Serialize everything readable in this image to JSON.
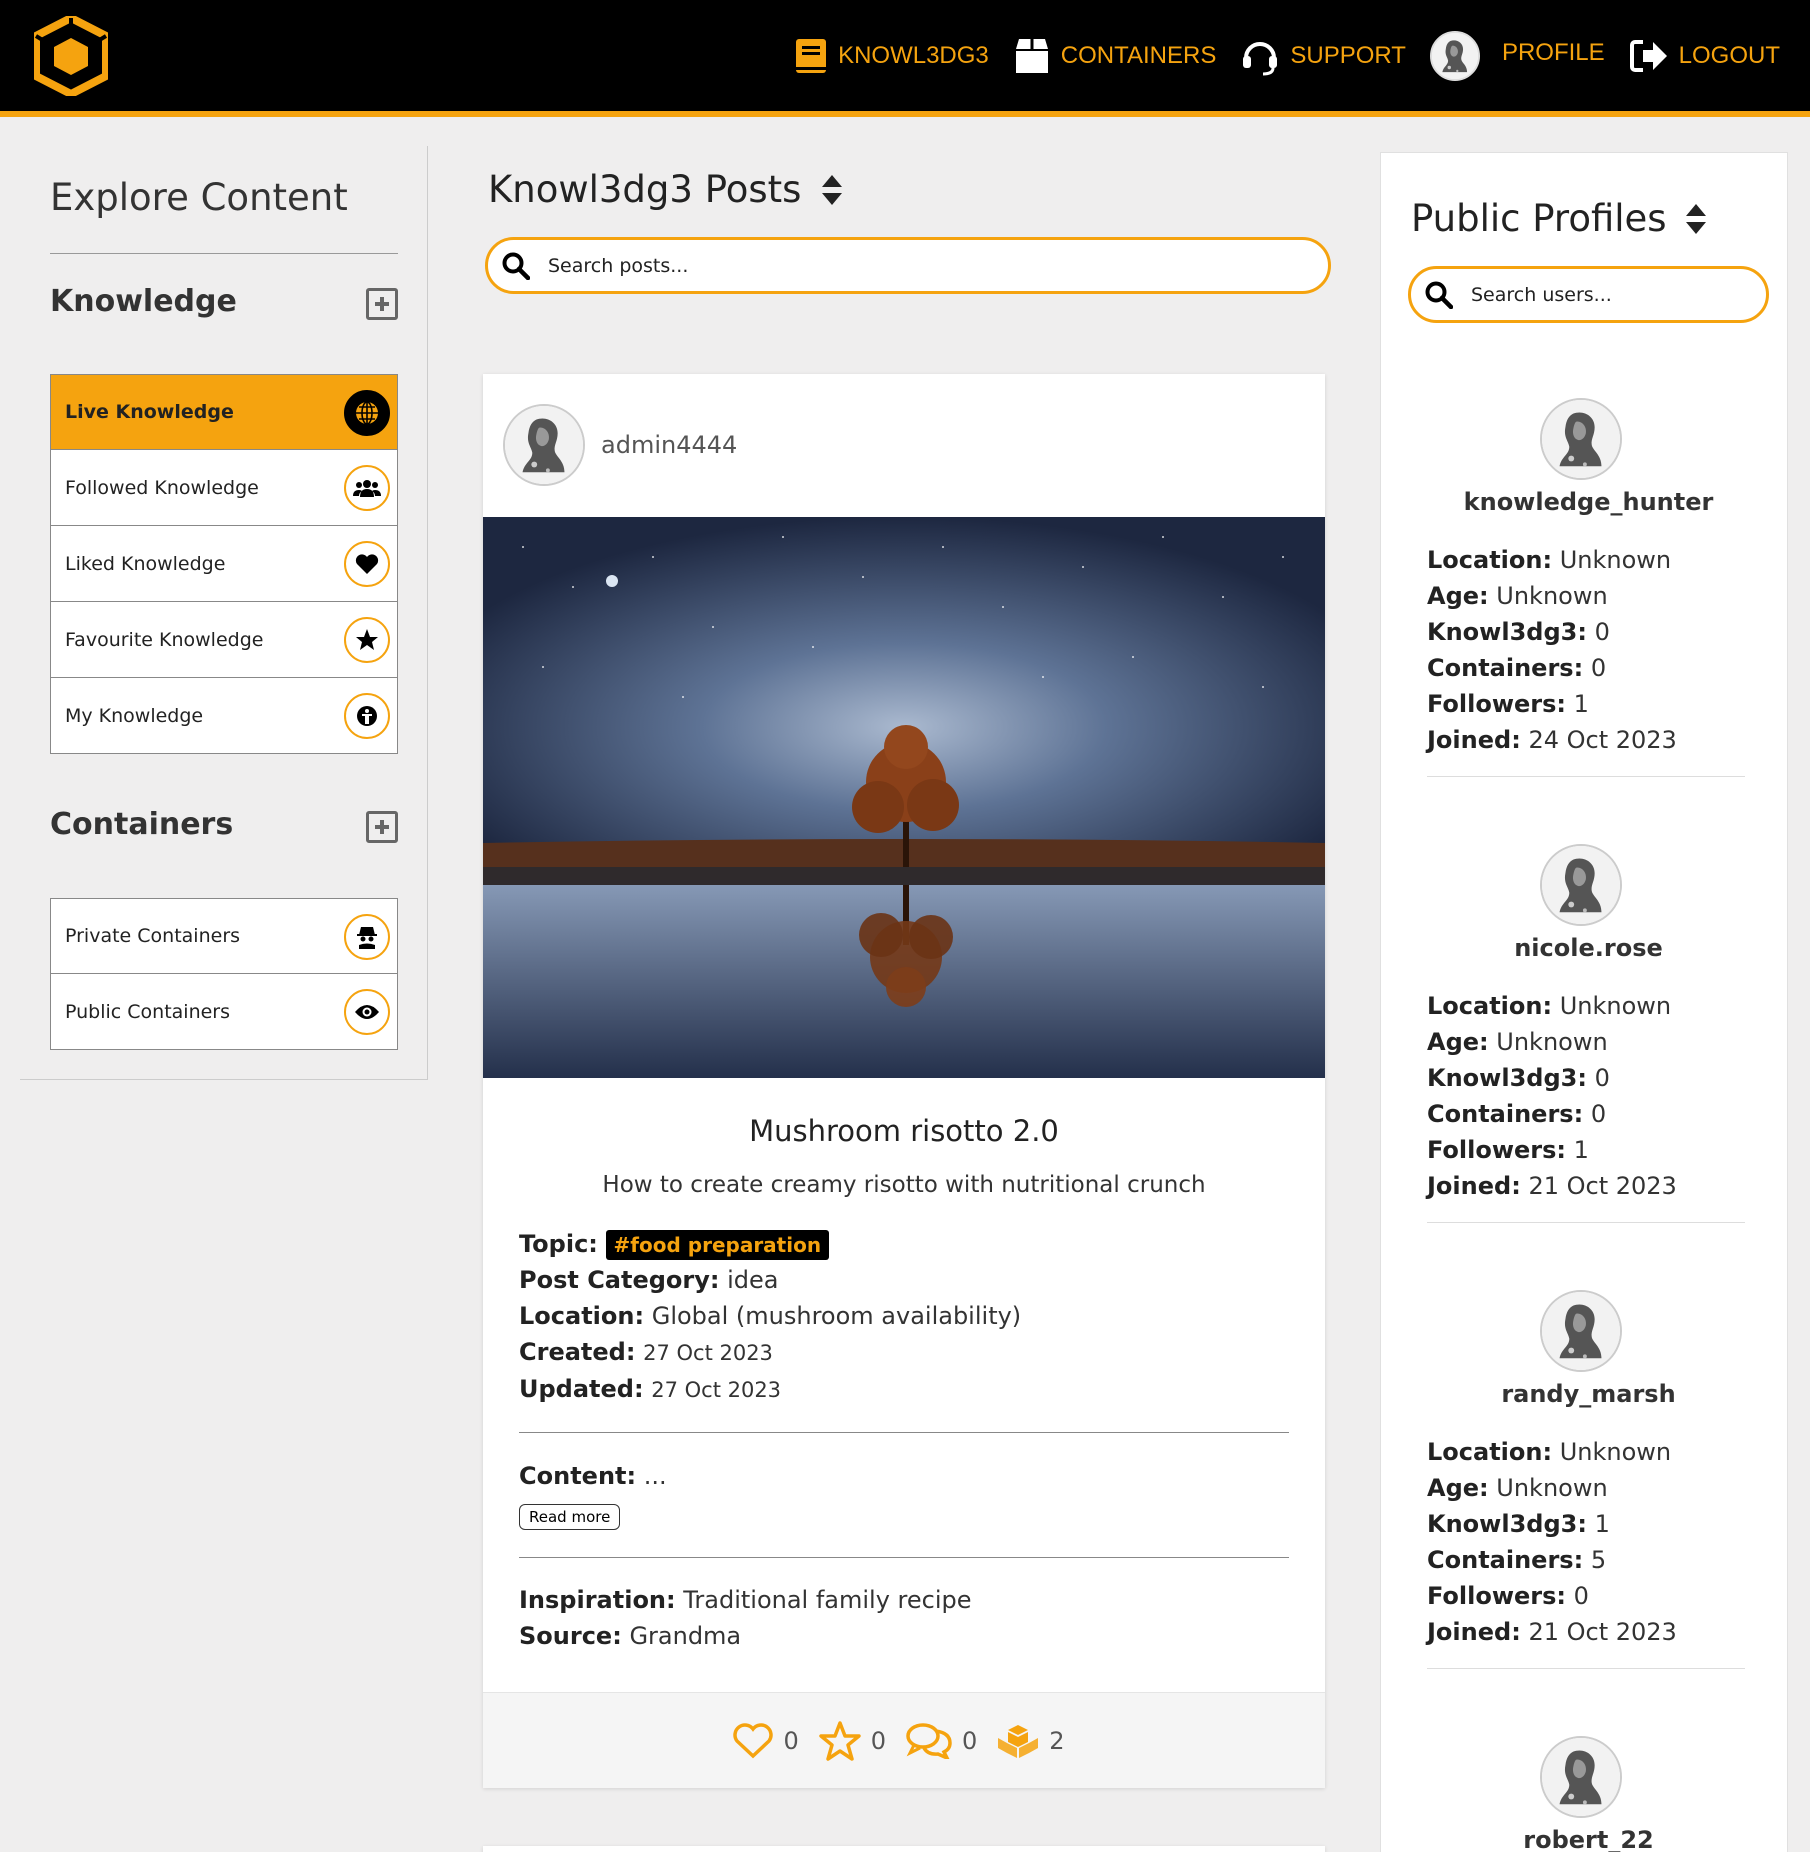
{
  "nav": {
    "links": [
      {
        "label": "KNOWL3DG3",
        "icon": "book-icon"
      },
      {
        "label": "CONTAINERS",
        "icon": "box-icon"
      },
      {
        "label": "SUPPORT",
        "icon": "headset-icon"
      },
      {
        "label": "PROFILE",
        "icon": "avatar"
      },
      {
        "label": "LOGOUT",
        "icon": "logout-icon"
      }
    ],
    "accent": "#f5a30f"
  },
  "sidebar": {
    "title": "Explore Content",
    "knowledge_heading": "Knowledge",
    "knowledge_items": [
      {
        "label": "Live Knowledge",
        "icon": "globe-icon",
        "active": true
      },
      {
        "label": "Followed Knowledge",
        "icon": "users-icon"
      },
      {
        "label": "Liked Knowledge",
        "icon": "heart-icon"
      },
      {
        "label": "Favourite Knowledge",
        "icon": "star-icon"
      },
      {
        "label": "My Knowledge",
        "icon": "person-icon"
      }
    ],
    "containers_heading": "Containers",
    "container_items": [
      {
        "label": "Private Containers",
        "icon": "spy-icon"
      },
      {
        "label": "Public Containers",
        "icon": "eye-icon"
      }
    ]
  },
  "main": {
    "title": "Knowl3dg3 Posts",
    "search_placeholder": "Search posts...",
    "post": {
      "author": "admin4444",
      "title": "Mushroom risotto 2.0",
      "subtitle": "How to create creamy risotto with nutritional crunch",
      "topic_label": "Topic:",
      "topic": "#food preparation",
      "category_label": "Post Category:",
      "category": "idea",
      "location_label": "Location:",
      "location": "Global (mushroom availability)",
      "created_label": "Created:",
      "created": "27 Oct 2023",
      "updated_label": "Updated:",
      "updated": "27 Oct 2023",
      "content_label": "Content:",
      "content": "...",
      "read_more": "Read more",
      "inspiration_label": "Inspiration:",
      "inspiration": "Traditional family recipe",
      "source_label": "Source:",
      "source": "Grandma",
      "likes": "0",
      "favourites": "0",
      "comments": "0",
      "containers": "2"
    }
  },
  "profiles": {
    "title": "Public Profiles",
    "search_placeholder": "Search users...",
    "labels": {
      "location": "Location:",
      "age": "Age:",
      "knowledge": "Knowl3dg3:",
      "containers": "Containers:",
      "followers": "Followers:",
      "joined": "Joined:"
    },
    "users": [
      {
        "name": "knowledge_hunter",
        "location": "Unknown",
        "age": "Unknown",
        "knowledge": "0",
        "containers": "0",
        "followers": "1",
        "joined": "24 Oct 2023"
      },
      {
        "name": "nicole.rose",
        "location": "Unknown",
        "age": "Unknown",
        "knowledge": "0",
        "containers": "0",
        "followers": "1",
        "joined": "21 Oct 2023"
      },
      {
        "name": "randy_marsh",
        "location": "Unknown",
        "age": "Unknown",
        "knowledge": "1",
        "containers": "5",
        "followers": "0",
        "joined": "21 Oct 2023"
      },
      {
        "name": "robert_22"
      }
    ]
  }
}
